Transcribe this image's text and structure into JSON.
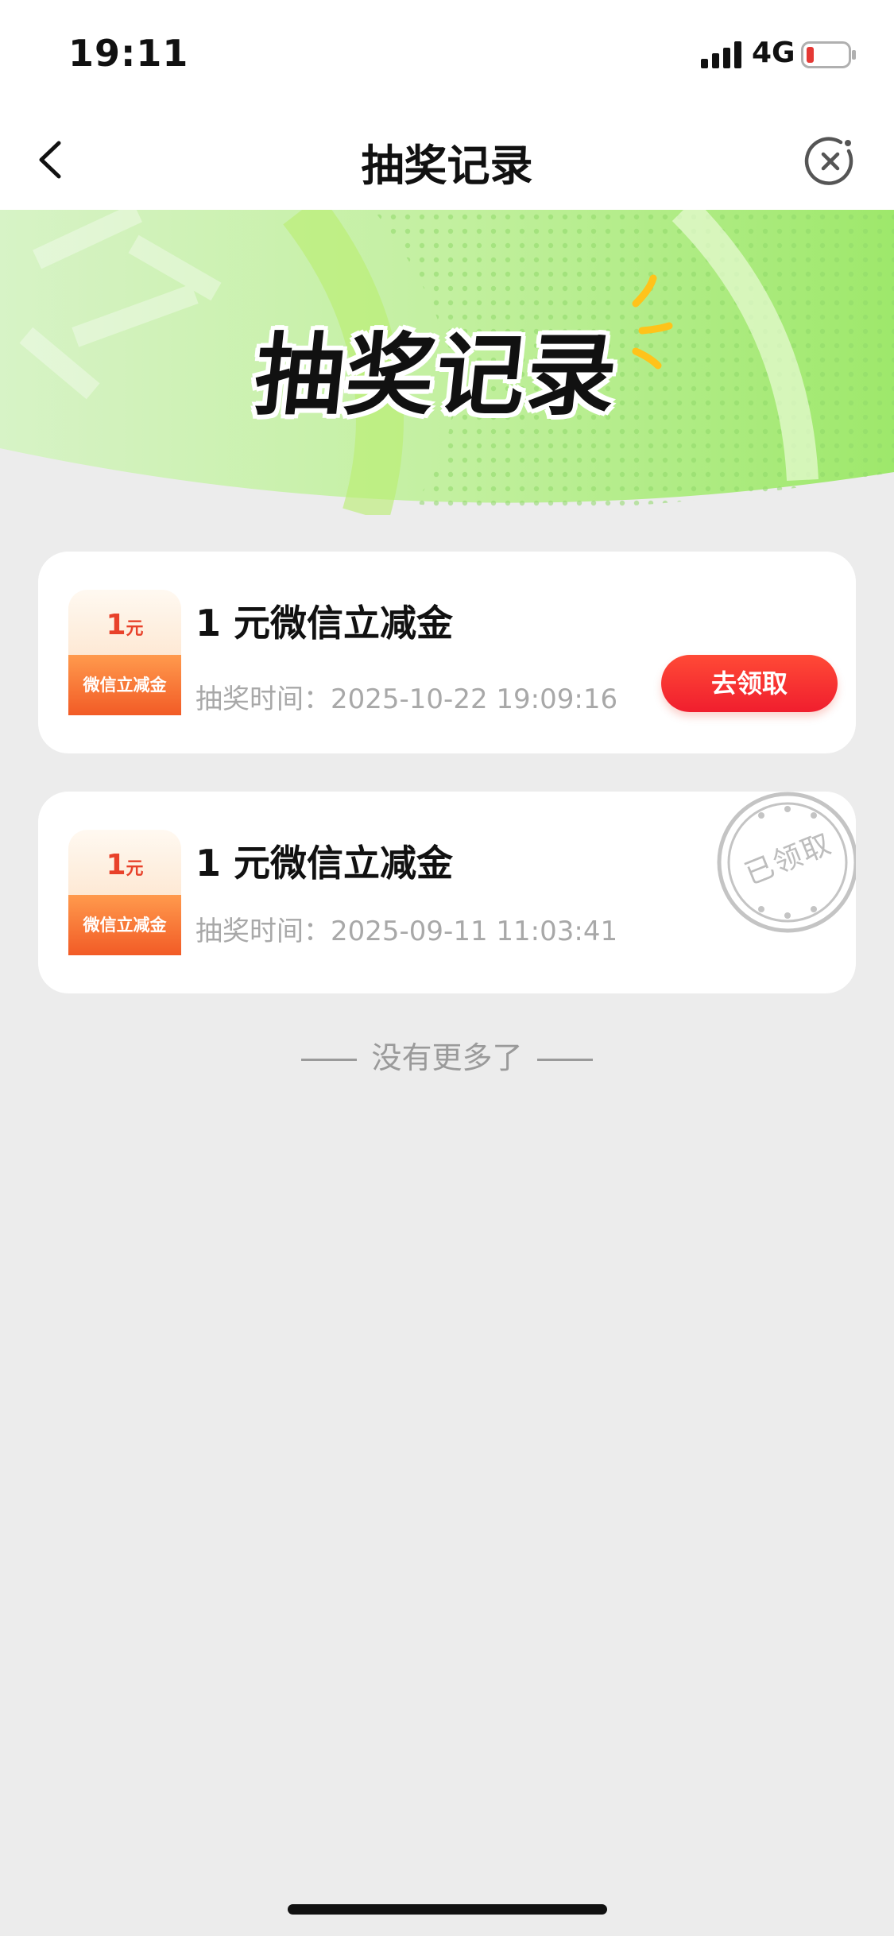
{
  "status_bar": {
    "time": "19:11",
    "network": "4G",
    "battery_color": "#e53935"
  },
  "nav": {
    "title": "抽奖记录",
    "back_icon": "chevron-left-icon",
    "close_icon": "close-circle-icon"
  },
  "banner": {
    "title": "抽奖记录",
    "accent_color": "#9ee86b"
  },
  "records": [
    {
      "thumb_amount": "1",
      "thumb_unit": "元",
      "thumb_label": "微信立减金",
      "title": "1 元微信立减金",
      "time_label": "抽奖时间：",
      "time_value": "2025-10-22 19:09:16",
      "action_label": "去领取"
    },
    {
      "thumb_amount": "1",
      "thumb_unit": "元",
      "thumb_label": "微信立减金",
      "title": "1 元微信立减金",
      "time_label": "抽奖时间：",
      "time_value": "2025-09-11 11:03:41",
      "stamp_label": "已领取"
    }
  ],
  "footer": {
    "end_text": "没有更多了"
  }
}
